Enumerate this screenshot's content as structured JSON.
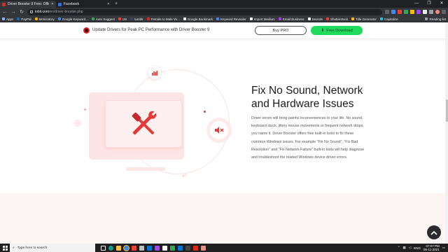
{
  "browser": {
    "tabs": [
      {
        "title": "Driver Booster 9 Free: Official Fr...",
        "favicon_color": "#e1251b",
        "active": true
      },
      {
        "title": "Facebook",
        "favicon_color": "#1877f2",
        "active": false
      }
    ],
    "new_tab": "+",
    "url_domain": "iobit.com",
    "url_path": "/en/driver-booster.php",
    "bookmarks": [
      {
        "label": "Apps",
        "color": "#8ab4f8"
      },
      {
        "label": "PayPal",
        "color": "#0070ba"
      },
      {
        "label": "MetricsKey",
        "color": "#f4b400"
      },
      {
        "label": "Google Keyword...",
        "color": "#4285f4"
      },
      {
        "label": "Auto Suggest",
        "color": "#34a853"
      },
      {
        "label": "US",
        "color": "#ea4335"
      },
      {
        "label": "tumblr",
        "color": "#35465c"
      },
      {
        "label": "Female to Male Vo...",
        "color": "#e1251b"
      },
      {
        "label": "Google Bookmark",
        "color": "#ffffff"
      },
      {
        "label": "Keyword Revealer",
        "color": "#4285f4"
      },
      {
        "label": "Import Medium",
        "color": "#ffffff"
      },
      {
        "label": "Email Business",
        "color": "#a142f4"
      },
      {
        "label": "Seorole",
        "color": "#ffffff"
      },
      {
        "label": "Shutterstock",
        "color": "#ea4335"
      },
      {
        "label": "Title Generator",
        "color": "#fbbc04"
      },
      {
        "label": "Capitalize",
        "color": "#24c1e0"
      }
    ],
    "reading_list": "Reading list"
  },
  "banner": {
    "text": "Update Drivers for Peak PC Performance with Driver Booster 9",
    "buy_label": "Buy PRO",
    "download_label": "Free Download"
  },
  "section": {
    "heading_line1": "Fix No Sound, Network",
    "heading_line2": "and Hardware Issues",
    "description": "Driver errors will bring painful inconveniences to your life. No sound, keyboard stuck, jittery mouse movements or frequent network drops, you name it. Driver Booster offers free built-in tools to fix these common Windows issues. For example \"Fix No Sound\", \"Fix Bad Resolution\" and \"Fix Network Failure\" built-in tools will help diagnose and troubleshoot the related Windows device driver errors."
  },
  "taskbar": {
    "search_placeholder": "Type here to search",
    "language": "ENG",
    "time": "07:07 PM",
    "date": "05-11-2021"
  },
  "colors": {
    "accent_red": "#e1251b",
    "download_green": "#1fdc5e",
    "illus_pink": "#fde5e5"
  }
}
